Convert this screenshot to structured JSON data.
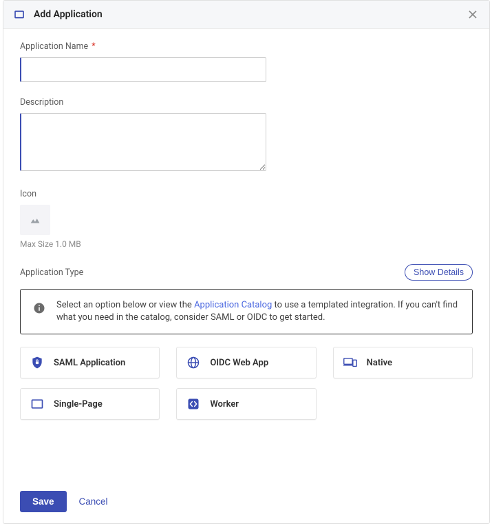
{
  "header": {
    "title": "Add Application"
  },
  "fields": {
    "app_name": {
      "label": "Application Name",
      "required_mark": "*",
      "value": ""
    },
    "description": {
      "label": "Description",
      "value": ""
    },
    "icon": {
      "label": "Icon",
      "helper": "Max Size 1.0 MB"
    }
  },
  "app_type": {
    "label": "Application Type",
    "show_details_label": "Show Details",
    "info_text_before": "Select an option below or view the ",
    "info_link": "Application Catalog",
    "info_text_after": " to use a templated integration. If you can't find what you need in the catalog, consider SAML or OIDC to get started.",
    "options": [
      {
        "label": "SAML Application"
      },
      {
        "label": "OIDC Web App"
      },
      {
        "label": "Native"
      },
      {
        "label": "Single-Page"
      },
      {
        "label": "Worker"
      }
    ]
  },
  "footer": {
    "save_label": "Save",
    "cancel_label": "Cancel"
  }
}
